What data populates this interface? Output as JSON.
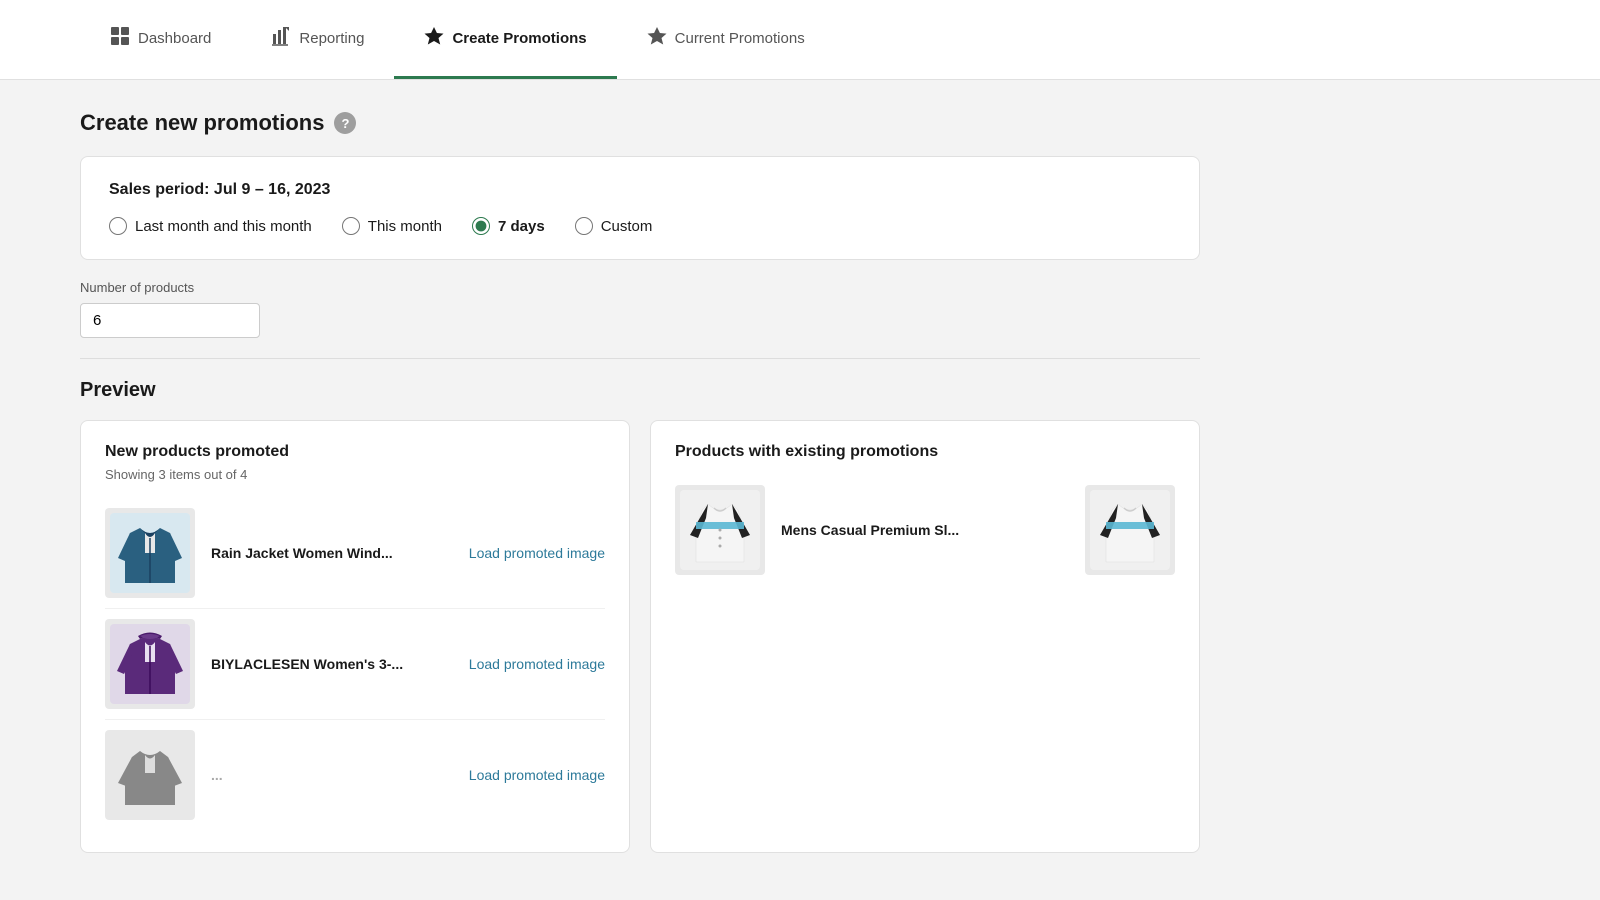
{
  "nav": {
    "tabs": [
      {
        "id": "dashboard",
        "label": "Dashboard",
        "icon": "🖥",
        "active": false
      },
      {
        "id": "reporting",
        "label": "Reporting",
        "icon": "📊",
        "active": false
      },
      {
        "id": "create-promotions",
        "label": "Create Promotions",
        "icon": "⭐",
        "active": true
      },
      {
        "id": "current-promotions",
        "label": "Current Promotions",
        "icon": "⭐",
        "active": false
      }
    ]
  },
  "page": {
    "title": "Create new promotions",
    "help_tooltip": "?"
  },
  "sales_period": {
    "label": "Sales period: Jul 9 – 16, 2023",
    "options": [
      {
        "id": "last-month-this-month",
        "label": "Last month and this month",
        "selected": false
      },
      {
        "id": "this-month",
        "label": "This month",
        "selected": false
      },
      {
        "id": "7-days",
        "label": "7 days",
        "selected": true
      },
      {
        "id": "custom",
        "label": "Custom",
        "selected": false
      }
    ]
  },
  "number_of_products": {
    "label": "Number of products",
    "value": "6"
  },
  "preview": {
    "title": "Preview",
    "new_products": {
      "title": "New products promoted",
      "showing": "Showing 3 items out of 4",
      "items": [
        {
          "id": "item-1",
          "name": "Rain Jacket Women Wind...",
          "load_label": "Load promoted image",
          "color": "blue"
        },
        {
          "id": "item-2",
          "name": "BIYLACLESEN Women's 3-...",
          "load_label": "Load promoted image",
          "color": "purple"
        },
        {
          "id": "item-3",
          "name": "...",
          "load_label": "Load promoted image",
          "color": "gray"
        }
      ]
    },
    "existing_promotions": {
      "title": "Products with existing promotions",
      "items": [
        {
          "id": "promo-1",
          "name": "Mens Casual Premium Sl...",
          "color": "shirt"
        },
        {
          "id": "promo-2",
          "name": "",
          "color": "shirt2"
        }
      ]
    }
  }
}
